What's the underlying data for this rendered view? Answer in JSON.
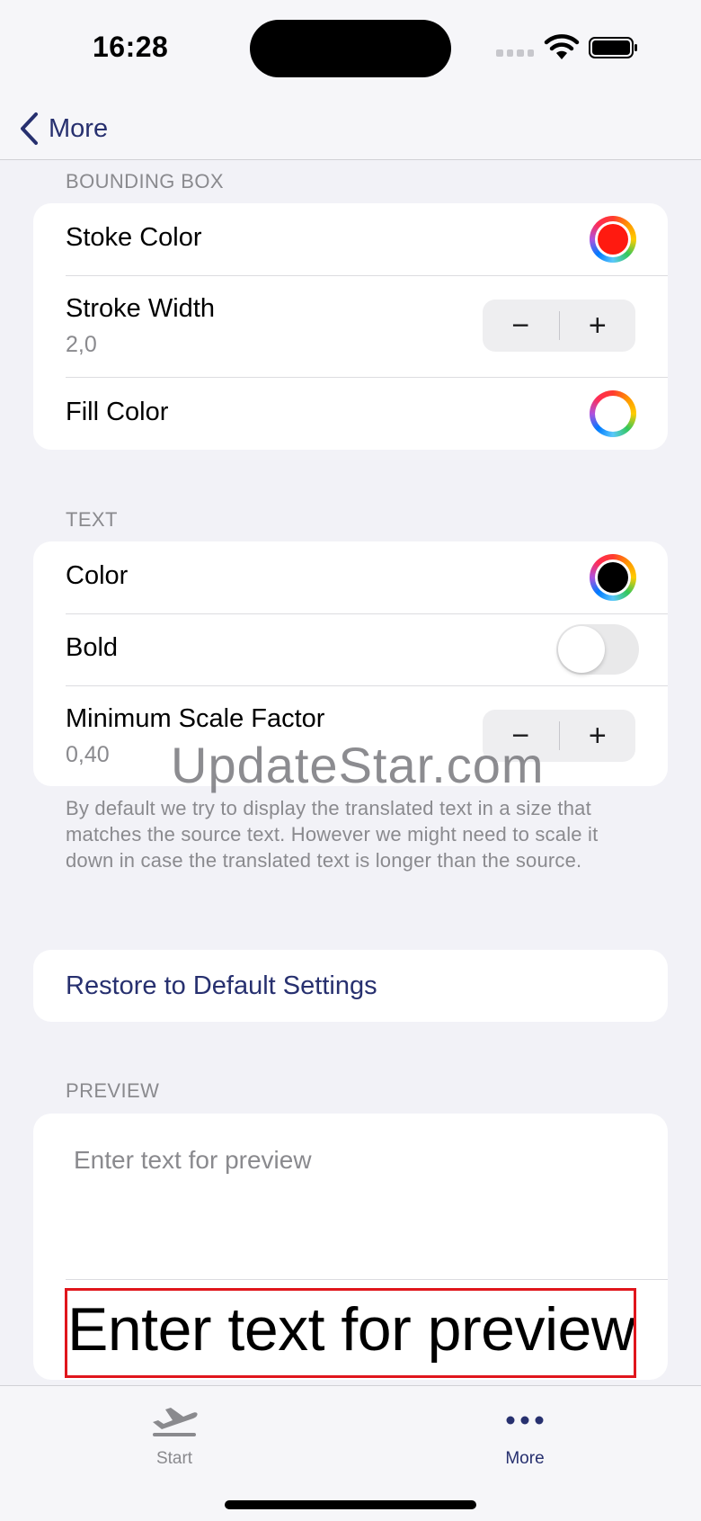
{
  "status_bar": {
    "time": "16:28"
  },
  "nav": {
    "back_label": "More"
  },
  "bounding_box": {
    "header": "BOUNDING BOX",
    "stroke_color_label": "Stoke Color",
    "stroke_color": "#ff1a10",
    "stroke_width_label": "Stroke Width",
    "stroke_width_value": "2,0",
    "fill_color_label": "Fill Color",
    "fill_color": "#ffffff"
  },
  "text_section": {
    "header": "TEXT",
    "color_label": "Color",
    "color": "#000000",
    "bold_label": "Bold",
    "bold_on": false,
    "min_scale_label": "Minimum Scale Factor",
    "min_scale_value": "0,40",
    "footnote": "By default we try to display the translated text in a size that matches the source text. However we might need to scale it down in case the translated text is longer than the source."
  },
  "stepper": {
    "minus": "−",
    "plus": "+"
  },
  "restore": {
    "label": "Restore to Default Settings"
  },
  "preview": {
    "header": "PREVIEW",
    "placeholder": "Enter text for preview",
    "rendered_text": "Enter text for preview",
    "box_color": "#e0161c"
  },
  "watermark": "UpdateStar.com",
  "tab_bar": {
    "tabs": [
      {
        "label": "Start",
        "icon": "airplane-takeoff-icon",
        "selected": false
      },
      {
        "label": "More",
        "icon": "ellipsis-icon",
        "selected": true
      }
    ],
    "selected_color": "#27306f",
    "unselected_color": "#8a8a8e"
  }
}
